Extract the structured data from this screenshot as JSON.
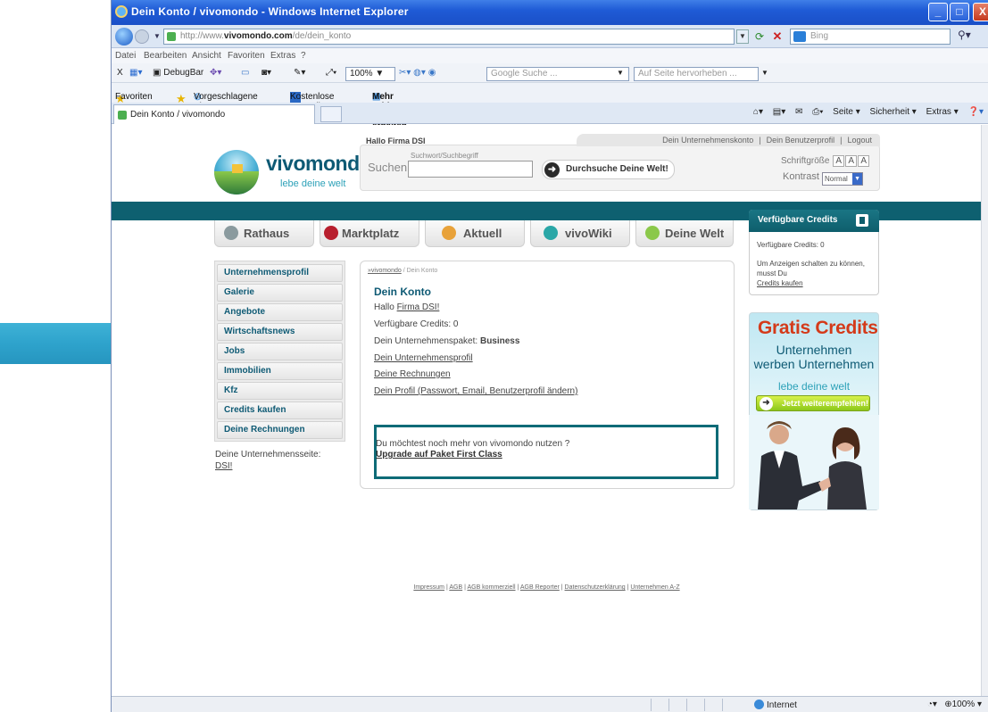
{
  "window": {
    "title": "Dein Konto / vivomondo - Windows Internet Explorer",
    "buttons": {
      "minimize": "_",
      "maximize": "□",
      "close": "X"
    }
  },
  "address_bar": {
    "url_prefix": "http://www.",
    "url_domain": "vivomondo.com",
    "url_path": "/de/dein_konto",
    "search_placeholder": "Bing"
  },
  "menu_bar": [
    "Datei",
    "Bearbeiten",
    "Ansicht",
    "Favoriten",
    "Extras",
    "?"
  ],
  "toolbar": {
    "close_x": "X",
    "debugbar": "DebugBar",
    "zoom": "100%",
    "google_placeholder": "Google Suche ...",
    "highlight_placeholder": "Auf Seite hervorheben ..."
  },
  "favorites_bar": {
    "favorites": "Favoriten",
    "suggested": "Vorgeschlagene Sites ▾",
    "hotmail": "Kostenlose Hotmail",
    "addons": "Mehr Add-ons erhalten ▾"
  },
  "tabs": {
    "active": "Dein Konto / vivomondo"
  },
  "command_bar": {
    "seite": "Seite ▾",
    "sicherheit": "Sicherheit ▾",
    "extras": "Extras ▾"
  },
  "site": {
    "logo_name": "vivomondo",
    "logo_tagline": "lebe deine welt",
    "greeting": "Hallo Firma DSI",
    "top_links": [
      "Dein Unternehmenskonto",
      "|",
      "Dein Benutzerprofil",
      "|",
      "Logout"
    ],
    "search_hint": "Suchwort/Suchbegriff",
    "search_label": "Suchen",
    "search_button": "Durchsuche Deine Welt!",
    "font_size_label": "Schriftgröße",
    "font_buttons": [
      "A",
      "A",
      "A"
    ],
    "contrast_label": "Kontrast",
    "contrast_value": "Normal"
  },
  "nav": [
    {
      "label": "Rathaus",
      "color": "#8a9a9e"
    },
    {
      "label": "Marktplatz",
      "color": "#b81f2e"
    },
    {
      "label": "Aktuell",
      "color": "#e8a23a"
    },
    {
      "label": "vivoWiki",
      "color": "#2aa7a7"
    },
    {
      "label": "Deine Welt",
      "color": "#8bc84a"
    }
  ],
  "left_menu": [
    "Unternehmensprofil",
    "Galerie",
    "Angebote",
    "Wirtschaftsnews",
    "Jobs",
    "Immobilien",
    "Kfz",
    "Credits kaufen",
    "Deine Rechnungen"
  ],
  "unternehmensseite": {
    "label": "Deine Unternehmensseite:",
    "link": "DSI!"
  },
  "main": {
    "breadcrumb_link": "»vivomondo",
    "breadcrumb_current": " / Dein Konto",
    "title": "Dein Konto",
    "hallo_prefix": "Hallo ",
    "hallo_link": "Firma DSI!",
    "credits": "Verfügbare Credits: 0",
    "paket_prefix": "Dein Unternehmenspaket: ",
    "paket_value": "Business",
    "links": [
      "Dein Unternehmensprofil",
      "Deine Rechnungen",
      "Dein Profil (Passwort, Email, Benutzerprofil ändern)"
    ],
    "upgrade_text": "Du möchtest noch mehr von vivomondo nutzen ?",
    "upgrade_link": "Upgrade auf Paket First Class"
  },
  "credits_box": {
    "title": "Verfügbare Credits",
    "available": "Verfügbare Credits: 0",
    "note": "Um Anzeigen schalten zu können, musst Du",
    "note_link": "Credits kaufen"
  },
  "ad": {
    "title": "Gratis Credits",
    "line1": "Unternehmen",
    "line2": "werben Unternehmen",
    "tagline": "lebe deine welt",
    "button": "Jetzt weiterempfehlen!"
  },
  "footer": [
    "Impressum",
    "AGB",
    "AGB kommerziell",
    "AGB Reporter",
    "Datenschutzerklärung",
    "Unternehmen A-Z"
  ],
  "status_bar": {
    "zone": "Internet",
    "zoom": "100%"
  },
  "colors": {
    "teal": "#0e6070",
    "brand": "#0e5a74",
    "accent_red": "#d43a1a"
  }
}
